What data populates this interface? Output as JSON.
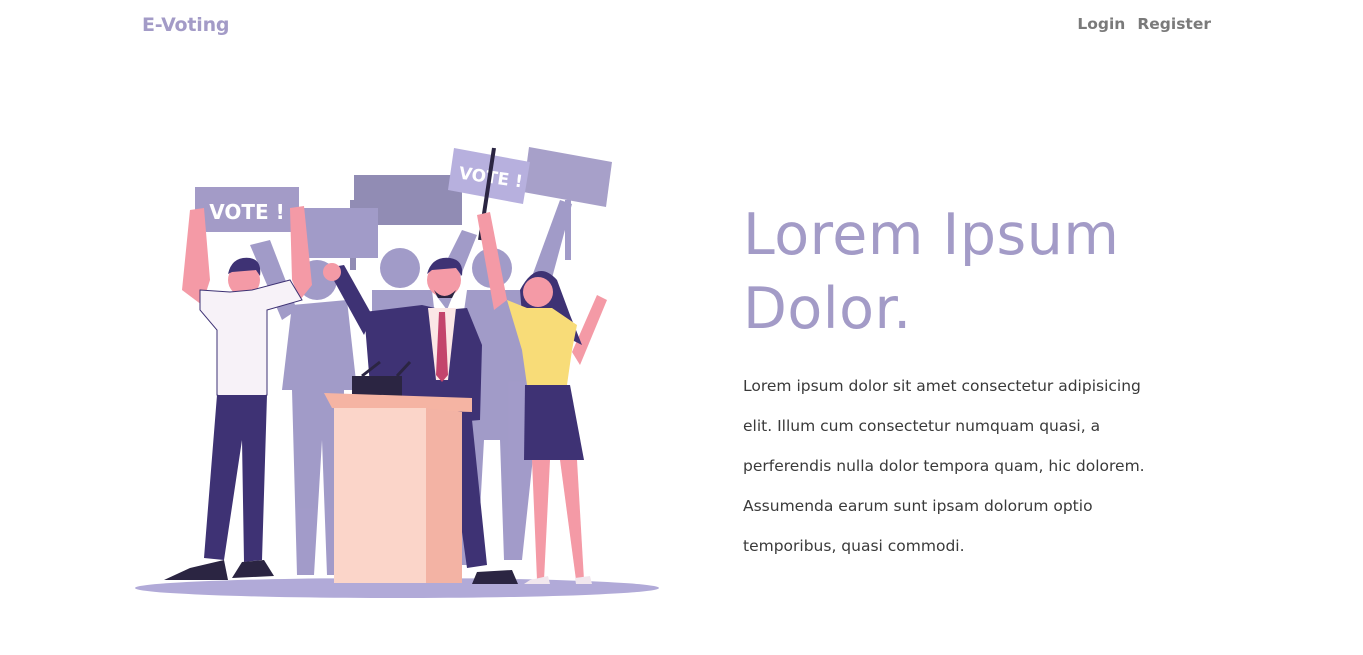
{
  "navbar": {
    "brand": "E-Voting",
    "links": [
      {
        "label": "Login"
      },
      {
        "label": "Register"
      }
    ]
  },
  "hero": {
    "title": "Lorem Ipsum Dolor.",
    "paragraph": "Lorem ipsum dolor sit amet consectetur adipisicing elit. Illum cum consectetur numquam quasi, a perferendis nulla dolor tempora quam, hic dolorem. Assumenda earum sunt ipsam dolorum optio temporibus, quasi commodi.",
    "illustration": {
      "sign_left": "VOTE !",
      "sign_right": "VOTE !"
    }
  },
  "colors": {
    "accent": "#a39bc7",
    "nav_text": "#7a7a7a",
    "body_text": "#3a3a3a",
    "navy": "#3e3274",
    "pink": "#f49aa6",
    "yellow": "#f8dc78",
    "podium": "#fbd5c9",
    "silhouette": "#9b94c4"
  }
}
